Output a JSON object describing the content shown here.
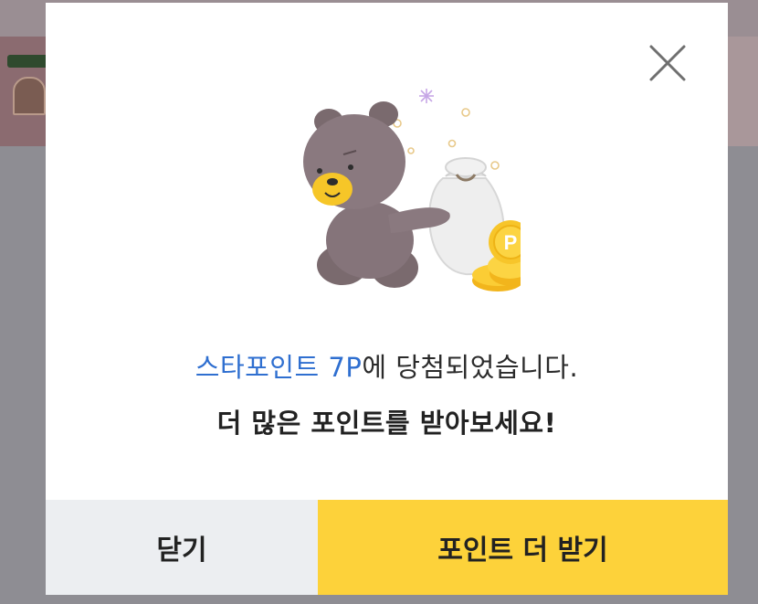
{
  "modal": {
    "message_highlight": "스타포인트 7P",
    "message_rest": "에 당첨되었습니다.",
    "message_sub": "더 많은 포인트를 받아보세요!",
    "close_icon": "close-icon",
    "illustration": "bear-with-point-money-bag",
    "coin_letter": "P"
  },
  "buttons": {
    "close_label": "닫기",
    "more_points_label": "포인트 더 받기"
  },
  "colors": {
    "highlight": "#2f6fd0",
    "primary_button": "#fdd23a",
    "secondary_button": "#eceef1",
    "backdrop": "#8e8d93"
  }
}
